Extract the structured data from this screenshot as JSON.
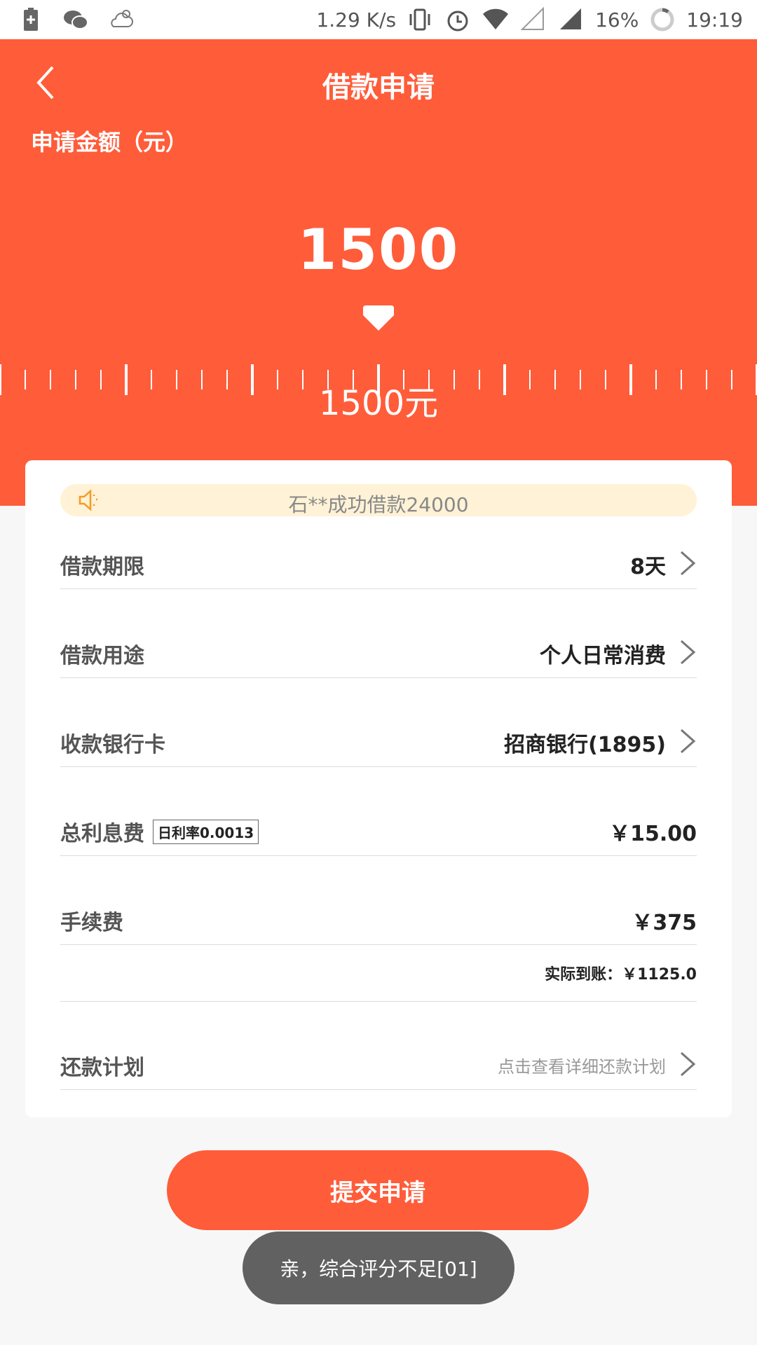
{
  "status_bar": {
    "speed": "1.29 K/s",
    "battery": "16%",
    "time": "19:19"
  },
  "header": {
    "title": "借款申请",
    "amount_label": "申请金额（元）",
    "amount": "1500",
    "ruler_label": "1500元"
  },
  "notice": {
    "text": "石**成功借款24000"
  },
  "rows": {
    "term": {
      "label": "借款期限",
      "value": "8天"
    },
    "purpose": {
      "label": "借款用途",
      "value": "个人日常消费"
    },
    "bank": {
      "label": "收款银行卡",
      "value": "招商银行(1895)"
    },
    "interest": {
      "label": "总利息费",
      "badge": "日利率0.0013",
      "value": "￥15.00"
    },
    "fee": {
      "label": "手续费",
      "value": "￥375"
    },
    "actual": "实际到账：￥1125.0",
    "plan": {
      "label": "还款计划",
      "value": "点击查看详细还款计划"
    }
  },
  "submit_label": "提交申请",
  "toast_text": "亲，综合评分不足[01]",
  "colors": {
    "accent": "#ff5c3a",
    "notice_bg": "#fff2d6"
  }
}
